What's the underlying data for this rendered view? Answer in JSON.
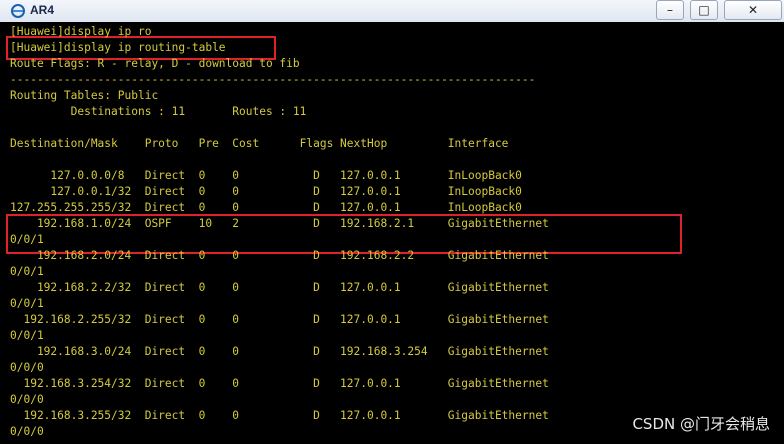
{
  "window": {
    "title": "AR4",
    "minimize_label": "–",
    "maximize_label": "□",
    "close_label": "✕",
    "accent": "#1a5fb4"
  },
  "terminal": {
    "text_color": "#d4cb3c",
    "background": "#000000",
    "highlight_color": "#e0202a",
    "lines": [
      "[Huawei]display ip ro",
      "[Huawei]display ip routing-table",
      "Route Flags: R - relay, D - download to fib",
      "------------------------------------------------------------------------------",
      "Routing Tables: Public",
      "         Destinations : 11       Routes : 11",
      "",
      "Destination/Mask    Proto   Pre  Cost      Flags NextHop         Interface",
      "",
      "      127.0.0.0/8   Direct  0    0           D   127.0.0.1       InLoopBack0",
      "      127.0.0.1/32  Direct  0    0           D   127.0.0.1       InLoopBack0",
      "127.255.255.255/32  Direct  0    0           D   127.0.0.1       InLoopBack0",
      "    192.168.1.0/24  OSPF    10   2           D   192.168.2.1     GigabitEthernet",
      "0/0/1",
      "    192.168.2.0/24  Direct  0    0           D   192.168.2.2     GigabitEthernet",
      "0/0/1",
      "    192.168.2.2/32  Direct  0    0           D   127.0.0.1       GigabitEthernet",
      "0/0/1",
      "  192.168.2.255/32  Direct  0    0           D   127.0.0.1       GigabitEthernet",
      "0/0/1",
      "    192.168.3.0/24  Direct  0    0           D   192.168.3.254   GigabitEthernet",
      "0/0/0",
      "  192.168.3.254/32  Direct  0    0           D   127.0.0.1       GigabitEthernet",
      "0/0/0",
      "  192.168.3.255/32  Direct  0    0           D   127.0.0.1       GigabitEthernet",
      "0/0/0"
    ]
  },
  "watermark": "CSDN @门牙会稍息"
}
